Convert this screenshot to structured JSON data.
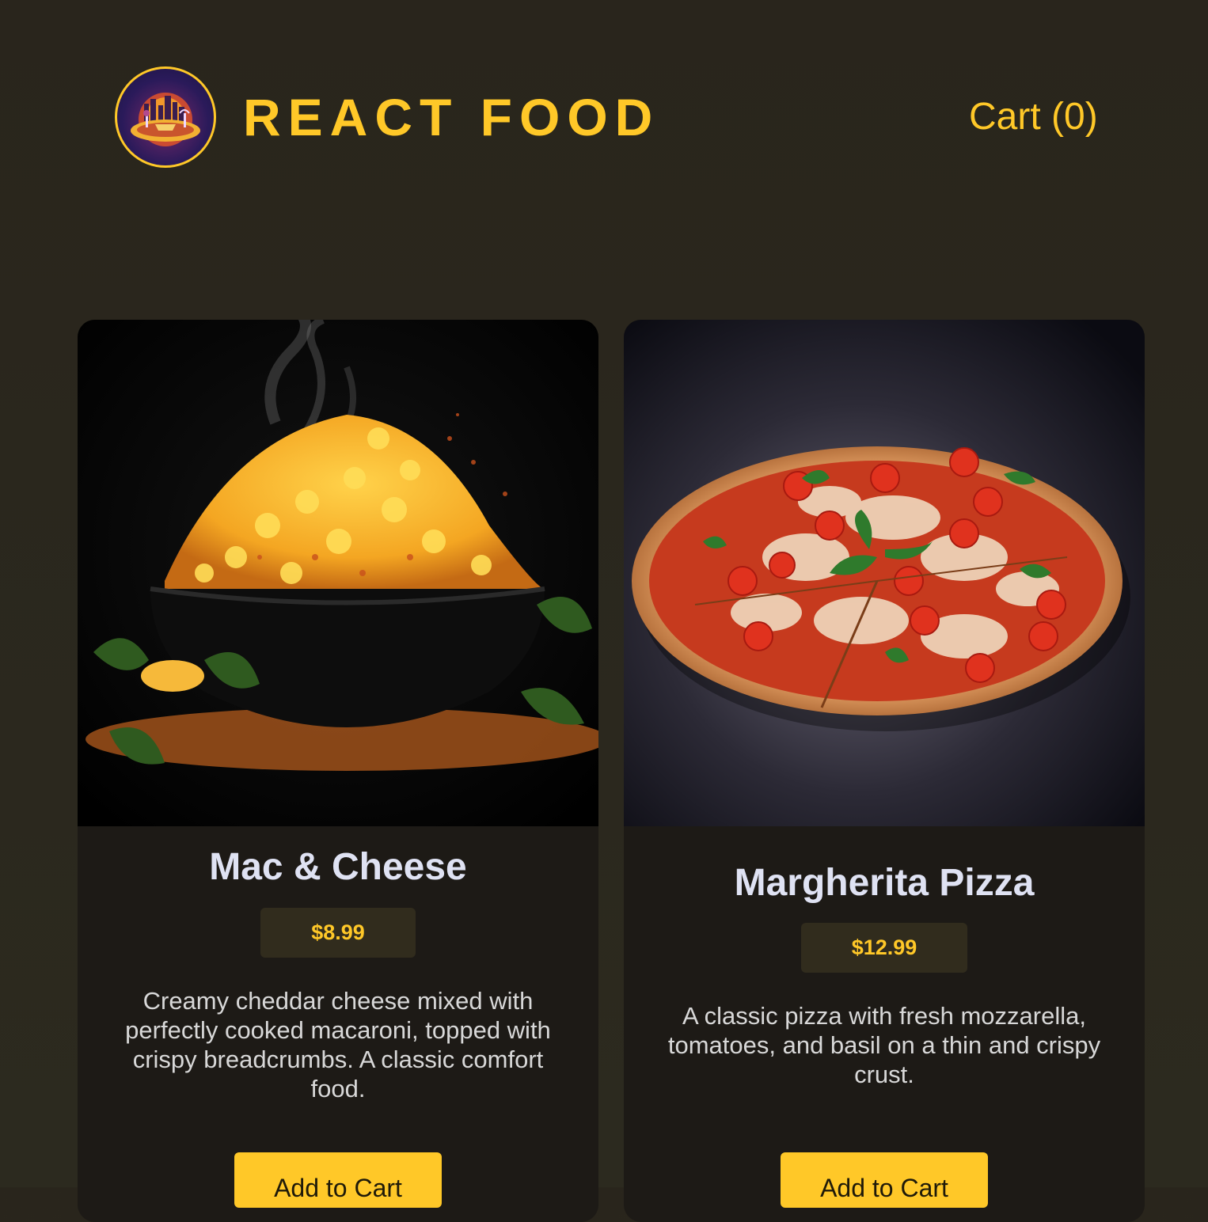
{
  "header": {
    "brand": "REACT FOOD",
    "cart_label": "Cart (0)"
  },
  "meals": [
    {
      "name": "Mac & Cheese",
      "price": "$8.99",
      "description": "Creamy cheddar cheese mixed with perfectly cooked macaroni, topped with crispy breadcrumbs. A classic comfort food.",
      "button_label": "Add to Cart"
    },
    {
      "name": "Margherita Pizza",
      "price": "$12.99",
      "description": "A classic pizza with fresh mozzarella, tomatoes, and basil on a thin and crispy crust.",
      "button_label": "Add to Cart"
    }
  ],
  "colors": {
    "accent": "#ffc828",
    "background": "#29251c",
    "card": "#1d1a16",
    "price_badge": "#312c1d",
    "title_text": "#dfe2f3"
  }
}
